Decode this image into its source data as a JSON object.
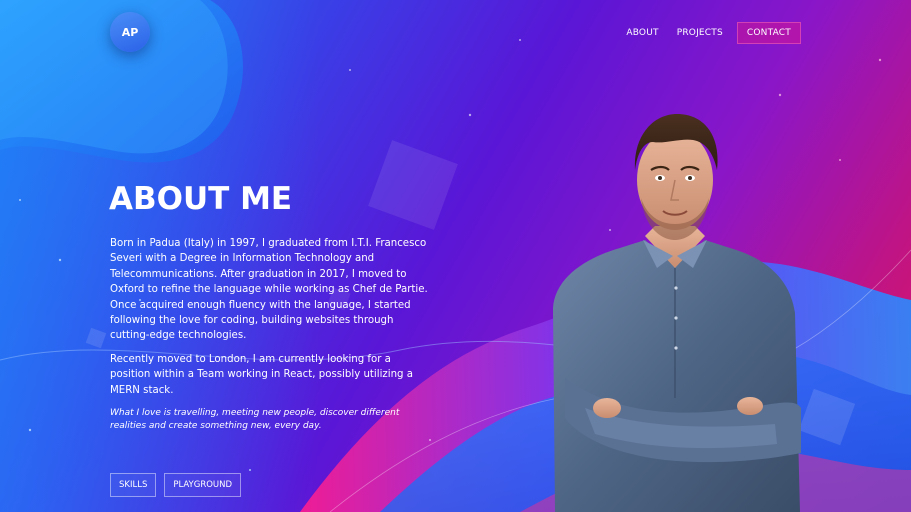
{
  "brand": {
    "logo_text": "AP"
  },
  "nav": {
    "items": [
      {
        "label": "ABOUT"
      },
      {
        "label": "PROJECTS"
      },
      {
        "label": "CONTACT"
      }
    ]
  },
  "about": {
    "title": "ABOUT ME",
    "paragraphs": [
      "Born in Padua (Italy) in 1997, I graduated from I.T.I. Francesco Severi with a Degree in Information Technology and Telecommunications. After graduation in 2017, I moved to Oxford to refine the language while working as Chef de Partie. Once acquired enough fluency with the language, I started following the love for coding, building websites through cutting-edge technologies.",
      "Recently moved to London, I am currently looking for a position within a Team working in React, possibly utilizing a MERN stack."
    ],
    "tagline": "What I love is travelling, meeting new people, discover different realities and create something new, every day."
  },
  "buttons": {
    "skills": "SKILLS",
    "playground": "PLAYGROUND"
  },
  "colors": {
    "gradient_start": "#1f7cf0",
    "gradient_mid": "#5a16d6",
    "gradient_end": "#e01467",
    "logo_bg": "#3a78f0",
    "contact_accent": "#ff1478"
  },
  "icons": {
    "portrait": "person-portrait-illustration"
  }
}
